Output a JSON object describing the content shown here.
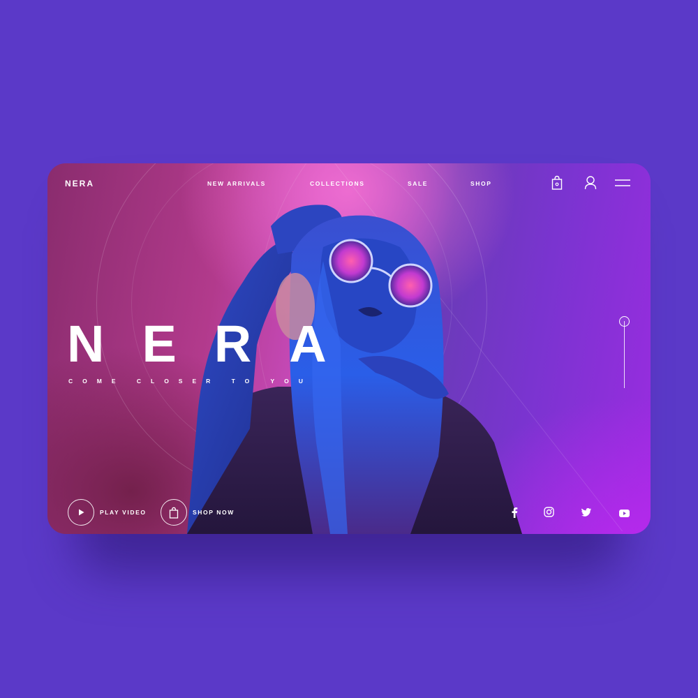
{
  "brand": {
    "logo": "NERA"
  },
  "nav": {
    "items": [
      {
        "label": "NEW ARRIVALS"
      },
      {
        "label": "COLLECTIONS"
      },
      {
        "label": "SALE"
      },
      {
        "label": "SHOP"
      }
    ],
    "icons": [
      "shopping-bag-icon",
      "user-icon",
      "menu-icon"
    ]
  },
  "hero": {
    "title": "NERA",
    "subtitle": "COME CLOSER TO YOU"
  },
  "actions": {
    "play_label": "PLAY VIDEO",
    "shop_label": "SHOP NOW"
  },
  "social": [
    "facebook-icon",
    "instagram-icon",
    "twitter-icon",
    "youtube-icon"
  ],
  "colors": {
    "page_background": "#5b39c8",
    "accent_pink": "#e04fb4",
    "accent_purple": "#9a2ce0",
    "text": "#ffffff"
  }
}
